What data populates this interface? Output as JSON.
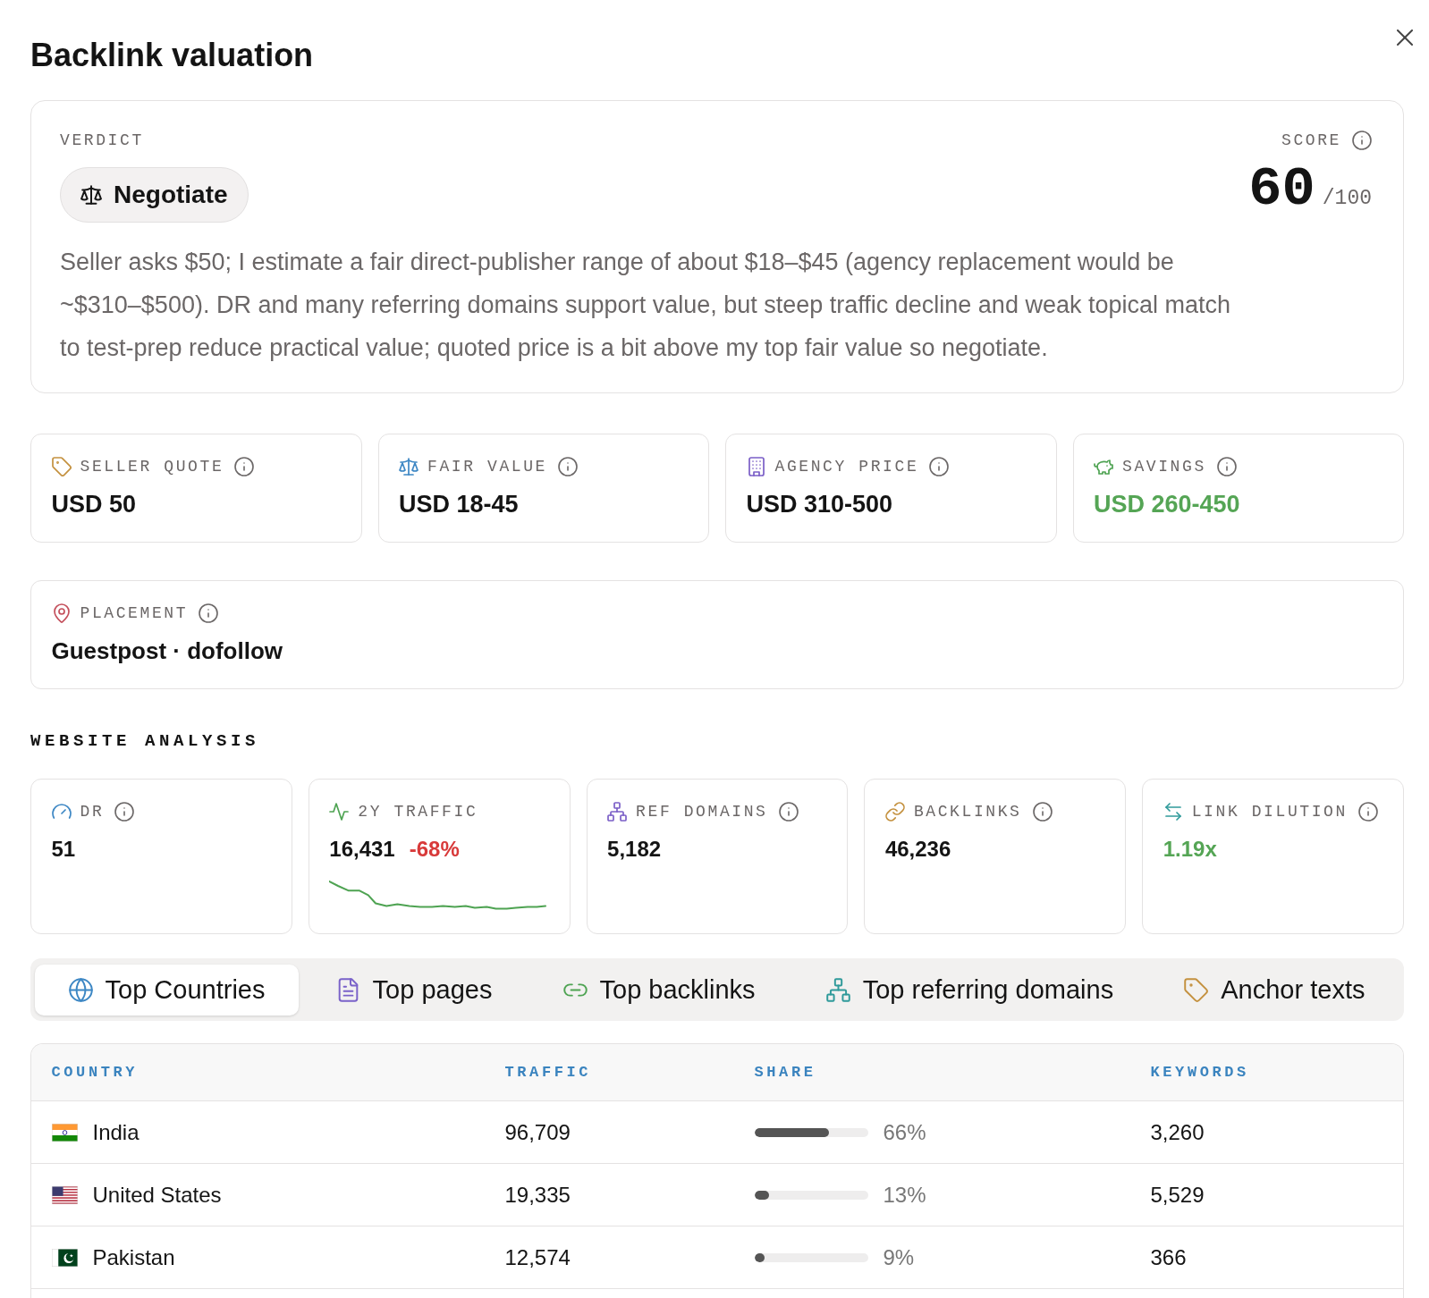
{
  "dialog": {
    "title": "Backlink valuation"
  },
  "verdict": {
    "label": "VERDICT",
    "decision": "Negotiate",
    "summary": "Seller asks $50; I estimate a fair direct-publisher range of about $18–$45 (agency replacement would be ~$310–$500). DR and many referring domains support value, but steep traffic decline and weak topical match to test-prep reduce practical value; quoted price is a bit above my top fair value so negotiate."
  },
  "score": {
    "label": "SCORE",
    "info": true,
    "value": "60",
    "max": "/100"
  },
  "prices": [
    {
      "label": "SELLER QUOTE",
      "info": true,
      "value": "USD 50",
      "color": "#141414"
    },
    {
      "label": "FAIR VALUE",
      "info": true,
      "value": "USD 18-45",
      "color": "#141414"
    },
    {
      "label": "AGENCY PRICE",
      "info": true,
      "value": "USD 310-500",
      "color": "#141414"
    },
    {
      "label": "SAVINGS",
      "info": true,
      "value": "USD 260-450",
      "color": "#55a555"
    }
  ],
  "placement": {
    "label": "PLACEMENT",
    "info": true,
    "value": "Guestpost · dofollow"
  },
  "analysis": {
    "title": "WEBSITE ANALYSIS",
    "metrics": [
      {
        "label": "DR",
        "info": true,
        "value": "51",
        "color": "#141414"
      },
      {
        "label": "2Y TRAFFIC",
        "info": false,
        "value": "16,431",
        "color": "#141414",
        "change": {
          "text": "-68%",
          "color": "#d83a3a"
        },
        "sparkline": true
      },
      {
        "label": "REF DOMAINS",
        "info": true,
        "value": "5,182",
        "color": "#141414"
      },
      {
        "label": "BACKLINKS",
        "info": true,
        "value": "46,236",
        "color": "#141414"
      },
      {
        "label": "LINK DILUTION",
        "info": true,
        "value": "1.19x",
        "color": "#55a555"
      }
    ]
  },
  "tabs": [
    {
      "label": "Top Countries",
      "selected": true
    },
    {
      "label": "Top pages",
      "selected": false
    },
    {
      "label": "Top backlinks",
      "selected": false
    },
    {
      "label": "Top referring domains",
      "selected": false
    },
    {
      "label": "Anchor texts",
      "selected": false
    }
  ],
  "table": {
    "columns": [
      "COUNTRY",
      "TRAFFIC",
      "SHARE",
      "KEYWORDS"
    ],
    "rows": [
      {
        "kind": "in",
        "country": "India",
        "traffic": "96,709",
        "share": "66%",
        "level": 0.66,
        "keywords": "3,260"
      },
      {
        "kind": "us",
        "country": "United States",
        "traffic": "19,335",
        "share": "13%",
        "level": 0.13,
        "keywords": "5,529"
      },
      {
        "kind": "pk",
        "country": "Pakistan",
        "traffic": "12,574",
        "share": "9%",
        "level": 0.09,
        "keywords": "366"
      }
    ]
  }
}
